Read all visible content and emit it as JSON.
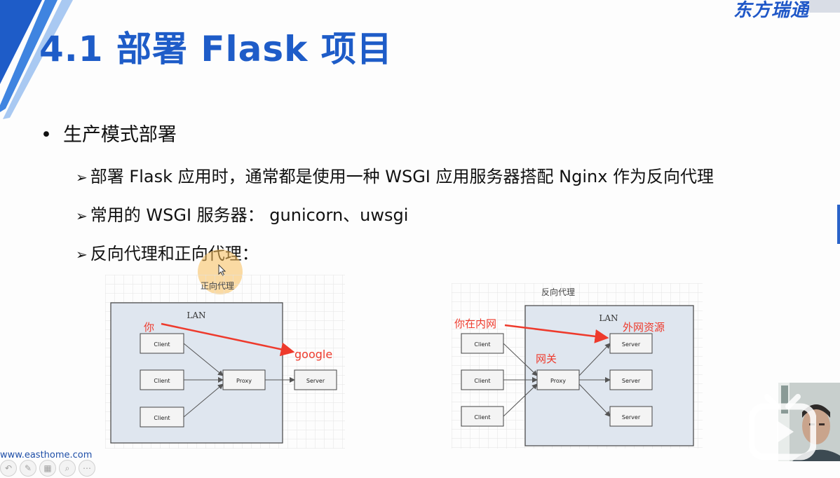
{
  "slide": {
    "brand_text": "东方瑞通",
    "title": "4.1 部署 Flask 项目",
    "bullet": "生产模式部署",
    "subitems": [
      {
        "arrow": "➢",
        "text": "部署 Flask 应用时，通常都是使用一种 WSGI 应用服务器搭配 Nginx 作为反向代理"
      },
      {
        "arrow": "➢",
        "text": "常用的 WSGI 服务器： gunicorn、uwsgi"
      },
      {
        "arrow": "➢",
        "text": "反向代理和正向代理："
      }
    ],
    "footer_url": "www.easthome.com"
  },
  "forward_proxy": {
    "caption": "正向代理",
    "lan_label": "LAN",
    "clients": [
      "Client",
      "Client",
      "Client"
    ],
    "proxy": "Proxy",
    "server": "Server",
    "annot_you": "你",
    "annot_google": "google"
  },
  "reverse_proxy": {
    "caption": "反向代理",
    "lan_label": "LAN",
    "clients": [
      "Client",
      "Client",
      "Client"
    ],
    "proxy": "Proxy",
    "servers": [
      "Server",
      "Server",
      "Server"
    ],
    "annot_intranet": "你在内网",
    "annot_gateway": "网关",
    "annot_resource": "外网资源"
  },
  "toolbar": {
    "icons": [
      "undo-icon",
      "draw-icon",
      "slides-icon",
      "zoom-icon",
      "more-icon"
    ]
  },
  "colors": {
    "title": "#1e5cc8",
    "accent": "#2a63c9",
    "annotation": "#ee3a2c",
    "lan_fill": "#dfe6ef"
  }
}
